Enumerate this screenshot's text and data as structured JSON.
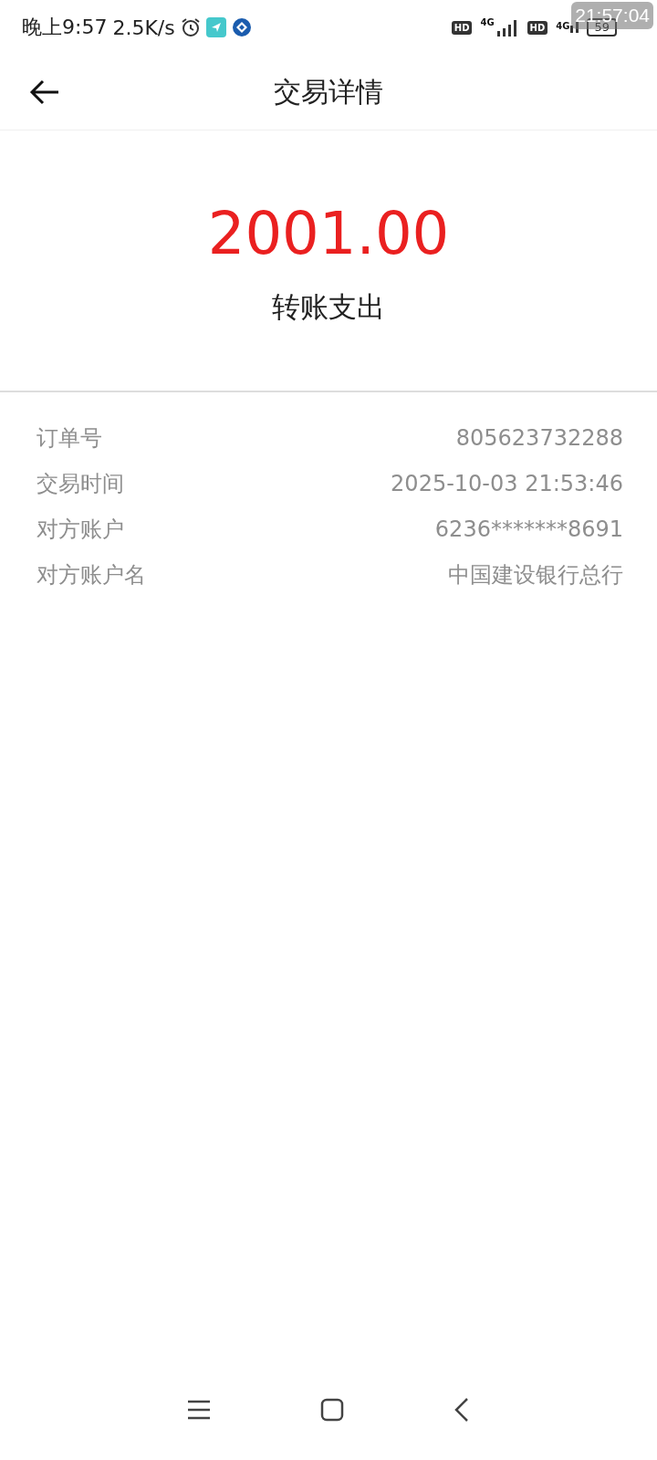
{
  "status_bar": {
    "time": "晚上9:57",
    "speed": "2.5K/s",
    "hd_1": "HD",
    "network_1": "4G",
    "hd_2": "HD",
    "network_2": "4G",
    "battery": "59",
    "overlay_clock": "21:57:04"
  },
  "header": {
    "title": "交易详情"
  },
  "summary": {
    "amount": "2001.00",
    "type": "转账支出"
  },
  "details": [
    {
      "label": "订单号",
      "value": "805623732288"
    },
    {
      "label": "交易时间",
      "value": "2025-10-03 21:53:46"
    },
    {
      "label": "对方账户",
      "value": "6236*******8691"
    },
    {
      "label": "对方账户名",
      "value": "中国建设银行总行"
    }
  ]
}
